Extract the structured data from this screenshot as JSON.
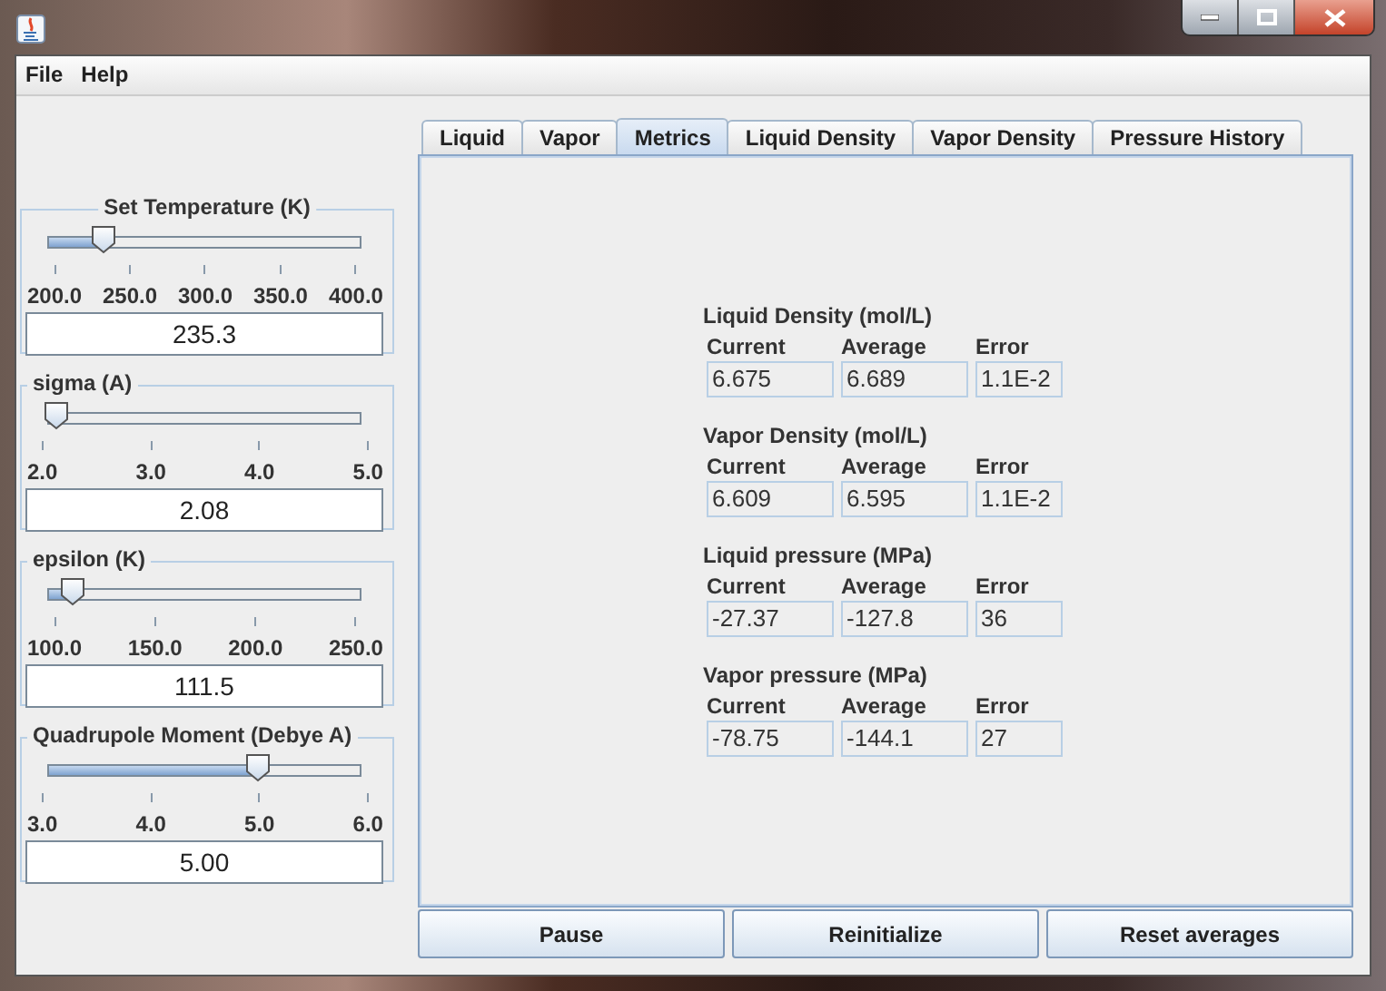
{
  "menu": [
    "File",
    "Help"
  ],
  "sliders": [
    {
      "title": "Set Temperature (K)",
      "kind": "centered",
      "level": 0.18,
      "ticks": [
        "200.0",
        "250.0",
        "300.0",
        "350.0",
        "400.0"
      ],
      "value": "235.3"
    },
    {
      "title": "sigma (A)",
      "kind": "plain",
      "level": 0.03,
      "ticks": [
        "2.0",
        "3.0",
        "4.0",
        "5.0"
      ],
      "value": "2.08"
    },
    {
      "title": "epsilon (K)",
      "kind": "plain",
      "level": 0.08,
      "ticks": [
        "100.0",
        "150.0",
        "200.0",
        "250.0"
      ],
      "value": "111.5"
    },
    {
      "title": "Quadrupole Moment (Debye A)",
      "kind": "plain",
      "level": 0.67,
      "ticks": [
        "3.0",
        "4.0",
        "5.0",
        "6.0"
      ],
      "value": "5.00"
    }
  ],
  "tabs": [
    {
      "label": "Liquid",
      "selected": false
    },
    {
      "label": "Vapor",
      "selected": false
    },
    {
      "label": "Metrics",
      "selected": true
    },
    {
      "label": "Liquid Density",
      "selected": false
    },
    {
      "label": "Vapor Density",
      "selected": false
    },
    {
      "label": "Pressure History",
      "selected": false
    }
  ],
  "metrics": {
    "groups": [
      {
        "title": "Liquid Density (mol/L)",
        "columns": [
          "Current",
          "Average",
          "Error"
        ],
        "values": [
          "6.675",
          "6.689",
          "1.1E-2"
        ]
      },
      {
        "title": "Vapor Density (mol/L)",
        "columns": [
          "Current",
          "Average",
          "Error"
        ],
        "values": [
          "6.609",
          "6.595",
          "1.1E-2"
        ]
      },
      {
        "title": "Liquid pressure (MPa)",
        "columns": [
          "Current",
          "Average",
          "Error"
        ],
        "values": [
          "-27.37",
          "-127.8",
          "36"
        ]
      },
      {
        "title": "Vapor pressure (MPa)",
        "columns": [
          "Current",
          "Average",
          "Error"
        ],
        "values": [
          "-78.75",
          "-144.1",
          "27"
        ]
      }
    ]
  },
  "buttons": [
    "Pause",
    "Reinitialize",
    "Reset averages"
  ]
}
